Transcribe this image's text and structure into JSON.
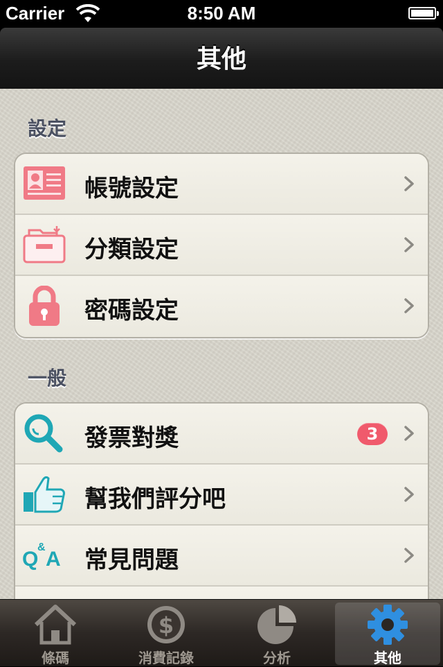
{
  "status_bar": {
    "carrier": "Carrier",
    "time": "8:50 AM"
  },
  "nav": {
    "title": "其他"
  },
  "sections": [
    {
      "header": "設定",
      "items": [
        {
          "label": "帳號設定",
          "icon": "id-card-icon"
        },
        {
          "label": "分類設定",
          "icon": "folder-icon"
        },
        {
          "label": "密碼設定",
          "icon": "lock-icon"
        }
      ]
    },
    {
      "header": "一般",
      "items": [
        {
          "label": "發票對獎",
          "icon": "search-icon",
          "badge": "3"
        },
        {
          "label": "幫我們評分吧",
          "icon": "thumbs-up-icon"
        },
        {
          "label": "常見問題",
          "icon": "qa-icon"
        }
      ]
    }
  ],
  "tabs": [
    {
      "label": "條碼",
      "icon": "home-icon"
    },
    {
      "label": "消費記錄",
      "icon": "dollar-coin-icon"
    },
    {
      "label": "分析",
      "icon": "pie-chart-icon"
    },
    {
      "label": "其他",
      "icon": "gear-icon",
      "active": true
    }
  ],
  "colors": {
    "accent_pink": "#f07a86",
    "accent_teal": "#1fa7b5",
    "badge": "#f05a6c",
    "active_tab_icon": "#2f8fe0"
  }
}
